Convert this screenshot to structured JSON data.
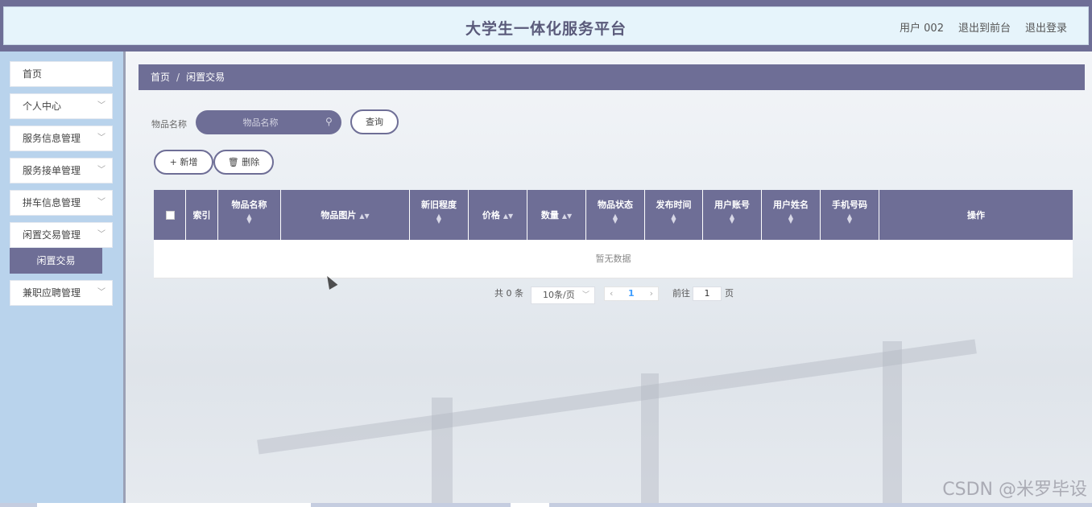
{
  "header": {
    "title": "大学生一体化服务平台",
    "user": "用户 002",
    "exit_front": "退出到前台",
    "logout": "退出登录"
  },
  "sidebar": {
    "items": [
      {
        "label": "首页",
        "has_chevron": false
      },
      {
        "label": "个人中心",
        "has_chevron": true
      },
      {
        "label": "服务信息管理",
        "has_chevron": true
      },
      {
        "label": "服务接单管理",
        "has_chevron": true
      },
      {
        "label": "拼车信息管理",
        "has_chevron": true
      },
      {
        "label": "闲置交易管理",
        "has_chevron": true
      },
      {
        "label": "兼职应聘管理",
        "has_chevron": true
      }
    ],
    "active_submenu": "闲置交易"
  },
  "breadcrumb": {
    "home": "首页",
    "separator": "/",
    "current": "闲置交易"
  },
  "search": {
    "label": "物品名称",
    "placeholder": "物品名称",
    "query_button": "查询"
  },
  "actions": {
    "add": "+ 新增",
    "delete": "🗑 删除"
  },
  "table": {
    "columns": [
      "索引",
      "物品名称",
      "物品图片",
      "新旧程度",
      "价格",
      "数量",
      "物品状态",
      "发布时间",
      "用户账号",
      "用户姓名",
      "手机号码",
      "操作"
    ],
    "empty_text": "暂无数据"
  },
  "pagination": {
    "total": "共 0 条",
    "page_size": "10条/页",
    "current_page": "1",
    "goto_label": "前往",
    "goto_value": "1",
    "page_unit": "页"
  },
  "watermark": "CSDN @米罗毕设",
  "colors": {
    "accent": "#6e6e96",
    "sidebar_bg": "#b9d3ec",
    "header_bg": "#e6f4fb"
  }
}
